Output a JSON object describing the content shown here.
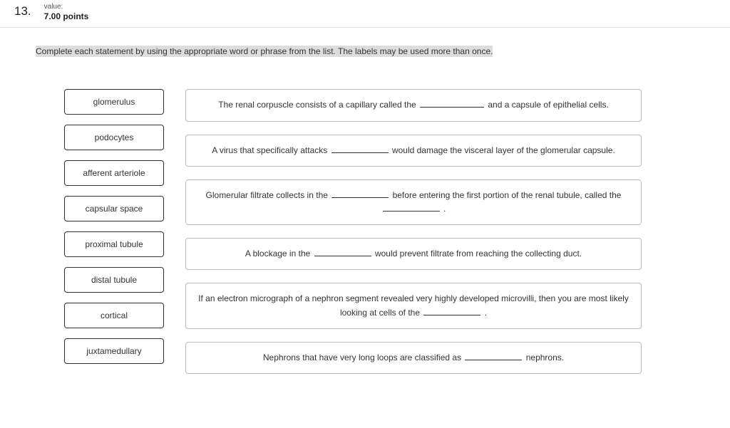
{
  "header": {
    "question_number": "13.",
    "value_label": "value:",
    "value_points": "7.00 points"
  },
  "instructions": "Complete each statement by using the appropriate word or phrase from the list. The labels may be used more than once.",
  "labels": [
    "glomerulus",
    "podocytes",
    "afferent arteriole",
    "capsular space",
    "proximal tubule",
    "distal tubule",
    "cortical",
    "juxtamedullary"
  ],
  "targets": [
    {
      "pre": "The renal corpuscle consists of a capillary called the ",
      "mid": " and a capsule of epithelial cells."
    },
    {
      "pre": "A virus that specifically attacks ",
      "mid": " would damage the visceral layer of the glomerular capsule."
    },
    {
      "pre": "Glomerular filtrate collects in the ",
      "mid": " before entering the first portion of the renal tubule, called the ",
      "post": " ."
    },
    {
      "pre": "A blockage in the ",
      "mid": " would prevent filtrate from reaching the collecting duct."
    },
    {
      "pre": "If an electron micrograph of a nephron segment revealed very highly developed microvilli, then you are most likely looking at cells of the ",
      "mid": " ."
    },
    {
      "pre": "Nephrons that have very long loops are classified as ",
      "mid": " nephrons."
    }
  ]
}
